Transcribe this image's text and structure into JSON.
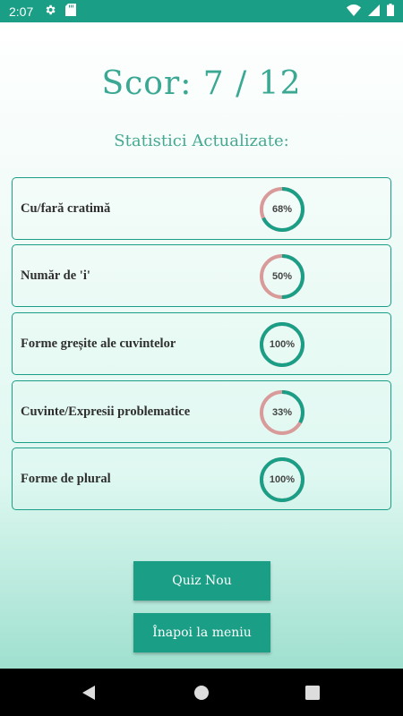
{
  "status_bar": {
    "time": "2:07",
    "icons_left": [
      "gear-icon",
      "sd-card-icon"
    ],
    "icons_right": [
      "wifi-icon",
      "signal-icon",
      "battery-icon"
    ]
  },
  "score": {
    "title": "Scor: 7 / 12"
  },
  "stats": {
    "title": "Statistici Actualizate:",
    "items": [
      {
        "label": "Cu/fară cratimă",
        "percent_label": "68%",
        "percent": 68
      },
      {
        "label": "Număr de 'i'",
        "percent_label": "50%",
        "percent": 50
      },
      {
        "label": "Forme greșite ale cuvintelor",
        "percent_label": "100%",
        "percent": 100
      },
      {
        "label": "Cuvinte/Expresii problematice",
        "percent_label": "33%",
        "percent": 33
      },
      {
        "label": "Forme de plural",
        "percent_label": "100%",
        "percent": 100
      }
    ]
  },
  "buttons": {
    "new_quiz": "Quiz Nou",
    "back_to_menu": "Înapoi la meniu"
  },
  "colors": {
    "accent": "#1a9e85",
    "ring_remaining": "#d99a9a"
  },
  "nav_bar": {
    "icons": [
      "back-icon",
      "home-icon",
      "recents-icon"
    ]
  }
}
